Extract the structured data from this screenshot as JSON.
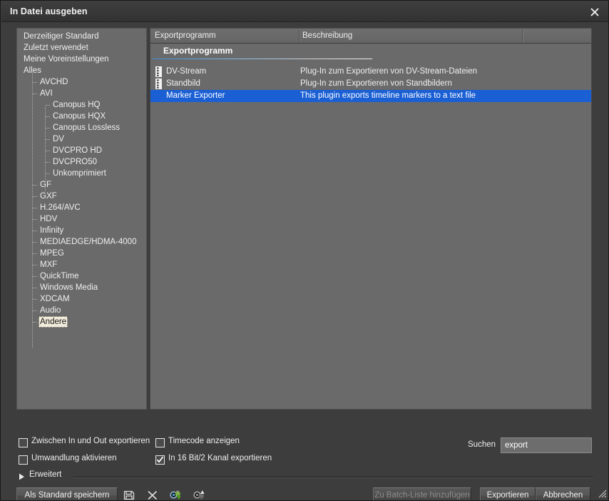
{
  "window": {
    "title": "In Datei ausgeben",
    "close_icon": "close-icon"
  },
  "tree": {
    "items": [
      {
        "label": "Derzeitiger Standard",
        "level": 0,
        "selected": false
      },
      {
        "label": "Zuletzt verwendet",
        "level": 0,
        "selected": false
      },
      {
        "label": "Meine Voreinstellungen",
        "level": 0,
        "selected": false
      },
      {
        "label": "Alles",
        "level": 0,
        "selected": false
      },
      {
        "label": "AVCHD",
        "level": 1,
        "selected": false
      },
      {
        "label": "AVI",
        "level": 1,
        "selected": false
      },
      {
        "label": "Canopus HQ",
        "level": 2,
        "selected": false
      },
      {
        "label": "Canopus HQX",
        "level": 2,
        "selected": false
      },
      {
        "label": "Canopus Lossless",
        "level": 2,
        "selected": false
      },
      {
        "label": "DV",
        "level": 2,
        "selected": false
      },
      {
        "label": "DVCPRO HD",
        "level": 2,
        "selected": false
      },
      {
        "label": "DVCPRO50",
        "level": 2,
        "selected": false
      },
      {
        "label": "Unkomprimiert",
        "level": 2,
        "selected": false
      },
      {
        "label": "GF",
        "level": 1,
        "selected": false
      },
      {
        "label": "GXF",
        "level": 1,
        "selected": false
      },
      {
        "label": "H.264/AVC",
        "level": 1,
        "selected": false
      },
      {
        "label": "HDV",
        "level": 1,
        "selected": false
      },
      {
        "label": "Infinity",
        "level": 1,
        "selected": false
      },
      {
        "label": "MEDIAEDGE/HDMA-4000",
        "level": 1,
        "selected": false
      },
      {
        "label": "MPEG",
        "level": 1,
        "selected": false
      },
      {
        "label": "MXF",
        "level": 1,
        "selected": false
      },
      {
        "label": "QuickTime",
        "level": 1,
        "selected": false
      },
      {
        "label": "Windows Media",
        "level": 1,
        "selected": false
      },
      {
        "label": "XDCAM",
        "level": 1,
        "selected": false
      },
      {
        "label": "Audio",
        "level": 1,
        "selected": false
      },
      {
        "label": "Andere",
        "level": 1,
        "selected": true
      }
    ]
  },
  "list": {
    "columns": [
      {
        "label": "Exportprogramm"
      },
      {
        "label": "Beschreibung"
      },
      {
        "label": ""
      }
    ],
    "group_header": "Exportprogramm",
    "rows": [
      {
        "name": "DV-Stream",
        "description": "Plug-In zum Exportieren von DV-Stream-Dateien",
        "icon": "film-strip-icon",
        "selected": false
      },
      {
        "name": "Standbild",
        "description": "Plug-In zum Exportieren von Standbildern",
        "icon": "film-strip-icon",
        "selected": false
      },
      {
        "name": "Marker Exporter",
        "description": "This plugin exports timeline markers to a text file",
        "icon": "",
        "selected": true
      }
    ]
  },
  "options": {
    "between_in_out": {
      "label": "Zwischen In und Out exportieren",
      "checked": false
    },
    "enable_conversion": {
      "label": "Umwandlung aktivieren",
      "checked": false
    },
    "show_timecode": {
      "label": "Timecode anzeigen",
      "checked": false
    },
    "export_16bit": {
      "label": "In 16 Bit/2 Kanal exportieren",
      "checked": true
    }
  },
  "expander": {
    "label": "Erweitert",
    "icon": "triangle-right-icon",
    "expanded": false
  },
  "search": {
    "label": "Suchen",
    "value": "export",
    "placeholder": ""
  },
  "toolbar": {
    "save_default_label": "Als Standard speichern",
    "icons": [
      {
        "name": "save-icon",
        "title": ""
      },
      {
        "name": "delete-icon",
        "title": ""
      },
      {
        "name": "import-preset-icon",
        "title": ""
      },
      {
        "name": "export-preset-icon",
        "title": ""
      }
    ]
  },
  "footer": {
    "batch_label": "Zu Batch-Liste hinzufügen",
    "batch_disabled": true,
    "export_label": "Exportieren",
    "cancel_label": "Abbrechen",
    "grip": "resize-grip-icon"
  },
  "colors": {
    "dialog_bg": "#3d3d3d",
    "panel_bg": "#6a6a6a",
    "selection_blue": "#1a5fd4",
    "tree_selection": "#f1ecdb",
    "text": "#efefef",
    "rule_blue": "#3b8fd6"
  }
}
